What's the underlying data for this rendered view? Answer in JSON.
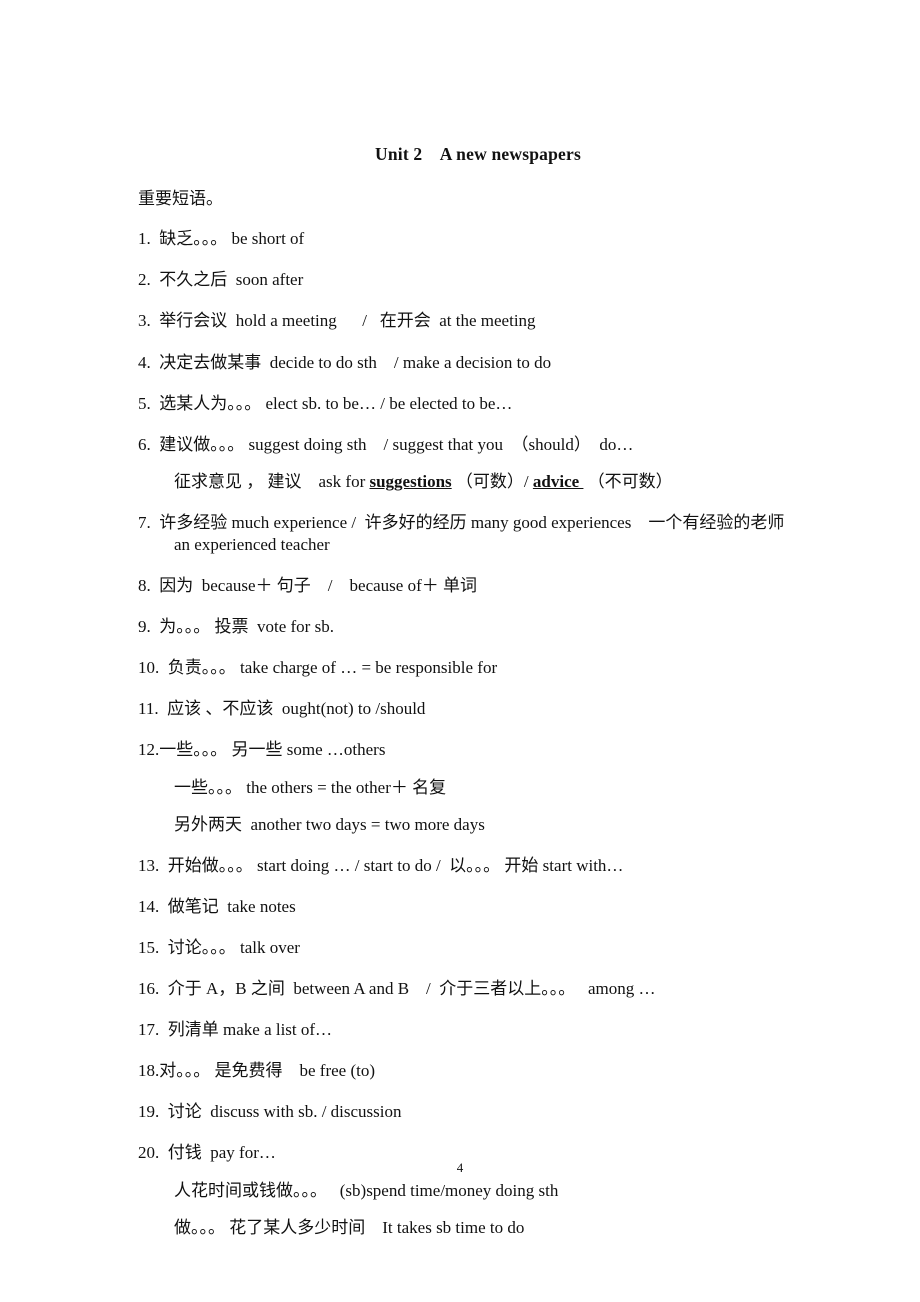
{
  "document": {
    "title": "Unit 2    A new newspapers",
    "section_heading": "重要短语。",
    "page_number": "4",
    "items": [
      {
        "num": "1.",
        "text": "  缺乏。。。 be short of",
        "tight": false
      },
      {
        "num": "2.",
        "text": "  不久之后  soon after",
        "tight": false
      },
      {
        "num": "3.",
        "text": "  举行会议  hold a meeting      /   在开会  at the meeting",
        "tight": false
      },
      {
        "num": "4.",
        "text": "  决定去做某事  decide to do sth    / make a decision to do",
        "tight": false
      },
      {
        "num": "5.",
        "text": "  选某人为。。。 elect sb. to be… / be elected to be…",
        "tight": false
      },
      {
        "num": "6.",
        "text": "  建议做。。。 suggest doing sth    / suggest that you  （should）  do…",
        "tight": false
      },
      {
        "num": "7.",
        "text": "  许多经验 much experience /  许多好的经历 many good experiences    一个有经验的老师  an experienced teacher",
        "tight": false
      },
      {
        "num": "8.",
        "text": "  因为  because＋ 句子    /    because of＋ 单词",
        "tight": false
      },
      {
        "num": "9.",
        "text": "  为。。。 投票  vote for sb.",
        "tight": false
      },
      {
        "num": "10.",
        "text": "  负责。。。 take charge of … = be responsible for",
        "tight": false
      },
      {
        "num": "11.",
        "text": "  应该 、不应该  ought(not) to /should",
        "tight": false
      },
      {
        "num": "12.",
        "text": "一些。。。 另一些 some …others",
        "tight": true
      },
      {
        "num": "13.",
        "text": "  开始做。。。 start doing … / start to do /  以。。。 开始 start with…",
        "tight": false
      },
      {
        "num": "14.",
        "text": "  做笔记  take notes",
        "tight": false
      },
      {
        "num": "15.",
        "text": "  讨论。。。 talk over",
        "tight": false
      },
      {
        "num": "16.",
        "text": "  介于 A，B 之间  between A and B    /  介于三者以上。。。   among …",
        "tight": false
      },
      {
        "num": "17.",
        "text": "  列清单 make a list of…",
        "tight": false
      },
      {
        "num": "18.",
        "text": "对。。。 是免费得    be free (to)",
        "tight": true
      },
      {
        "num": "19.",
        "text": "  讨论  discuss with sb. / discussion",
        "tight": false
      },
      {
        "num": "20.",
        "text": "  付钱  pay for…",
        "tight": false
      }
    ],
    "sublines": {
      "item6_prefix": "征求意见 ， 建议    ask for ",
      "item6_bold1": "suggestions",
      "item6_mid": " （可数）/ ",
      "item6_bold2": "advice ",
      "item6_suffix": " （不可数）",
      "item12_a": "一些。。。 the others = the other＋ 名复",
      "item12_b": "另外两天  another two days = two more days",
      "item20_a": "人花时间或钱做。。。   (sb)spend time/money doing sth",
      "item20_b": "做。。。 花了某人多少时间    It takes sb time to do"
    }
  }
}
